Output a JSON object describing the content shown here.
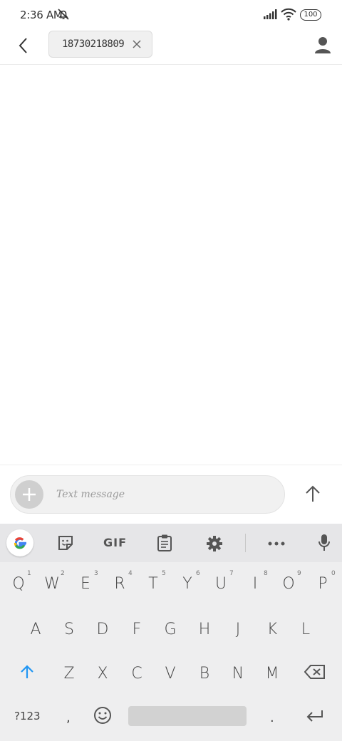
{
  "status_bar": {
    "time": "2:36 AM",
    "battery": "100",
    "icons": [
      "dnd-off-icon",
      "signal-icon",
      "wifi-icon",
      "battery-icon"
    ]
  },
  "header": {
    "back_icon": "back-arrow-icon",
    "recipient": "18730218809",
    "chip_close_icon": "close-icon",
    "contact_icon": "person-icon"
  },
  "compose": {
    "placeholder": "Text message",
    "attach_icon": "plus-icon",
    "send_icon": "send-arrow-icon"
  },
  "keyboard": {
    "toolbar": [
      "google-icon",
      "sticker-icon",
      "GIF",
      "clipboard-icon",
      "gear-icon",
      "more-icon",
      "mic-icon"
    ],
    "gif_label": "GIF",
    "row1": [
      {
        "k": "Q",
        "h": "1"
      },
      {
        "k": "W",
        "h": "2"
      },
      {
        "k": "E",
        "h": "3"
      },
      {
        "k": "R",
        "h": "4"
      },
      {
        "k": "T",
        "h": "5"
      },
      {
        "k": "Y",
        "h": "6"
      },
      {
        "k": "U",
        "h": "7"
      },
      {
        "k": "I",
        "h": "8"
      },
      {
        "k": "O",
        "h": "9"
      },
      {
        "k": "P",
        "h": "0"
      }
    ],
    "row2": [
      "A",
      "S",
      "D",
      "F",
      "G",
      "H",
      "J",
      "K",
      "L"
    ],
    "row3": [
      "Z",
      "X",
      "C",
      "V",
      "B",
      "N",
      "M"
    ],
    "symbols_label": "?123",
    "comma": ",",
    "period": ".",
    "colors": {
      "shift": "#2196f3",
      "toolbar_bg": "#e6e6e8",
      "keyboard_bg": "#eeeeef"
    }
  }
}
